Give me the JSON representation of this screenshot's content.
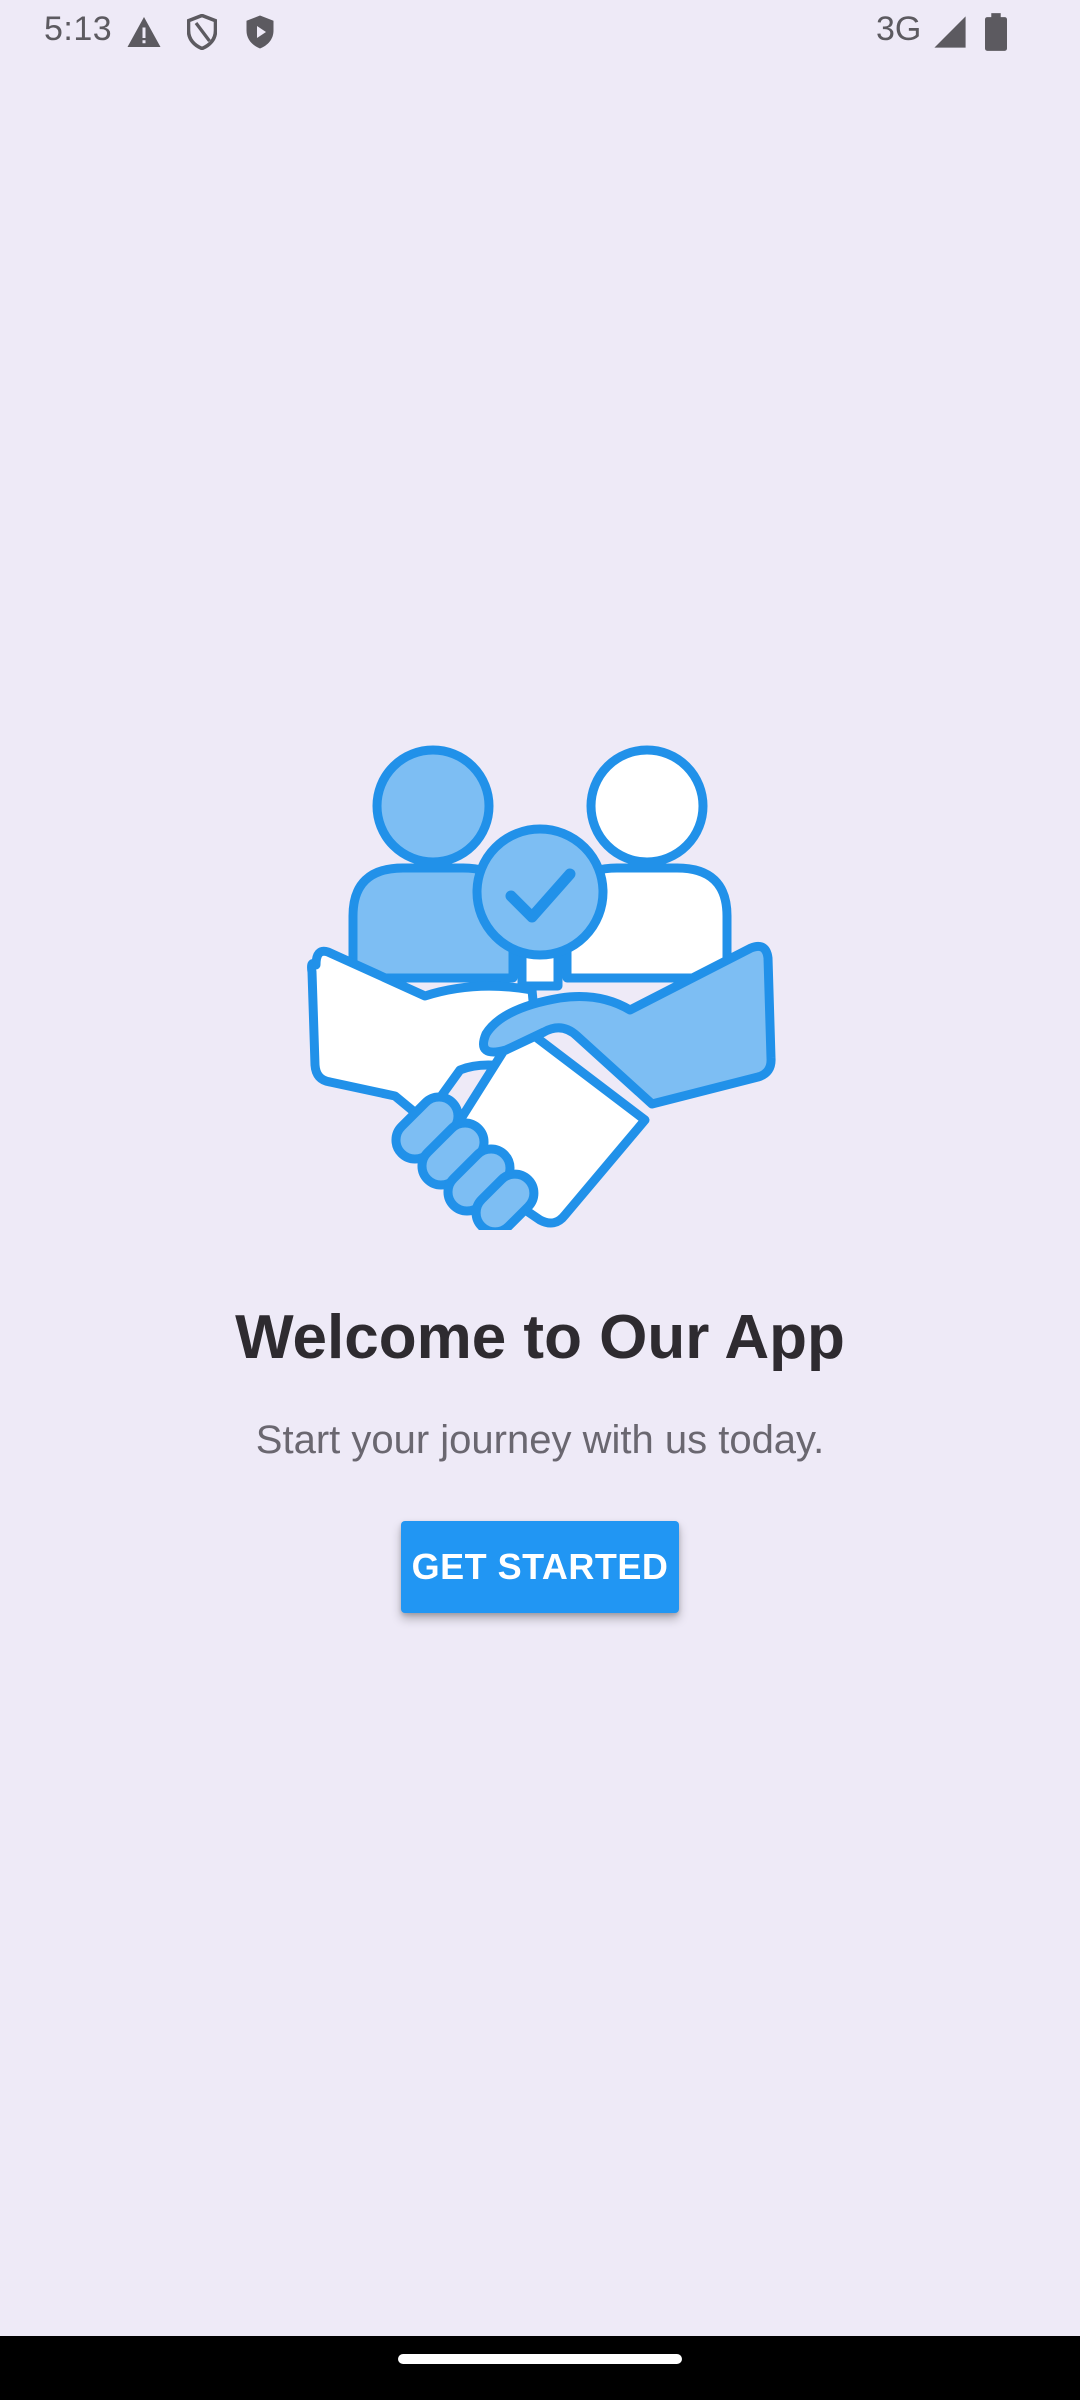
{
  "status_bar": {
    "time": "5:13",
    "network": "3G",
    "icons": [
      "warning-icon",
      "shield-outline-icon",
      "shield-play-icon",
      "signal-icon",
      "battery-icon"
    ]
  },
  "welcome": {
    "illustration": "handshake-people-check-illustration",
    "title": "Welcome to Our App",
    "subtitle": "Start your journey with us today.",
    "button_label": "GET STARTED"
  },
  "colors": {
    "background": "#EEEAF7",
    "accent": "#2196F3",
    "illustration_fill": "#7DBEF3",
    "title": "#2E2B30",
    "subtitle": "#6A6770"
  }
}
